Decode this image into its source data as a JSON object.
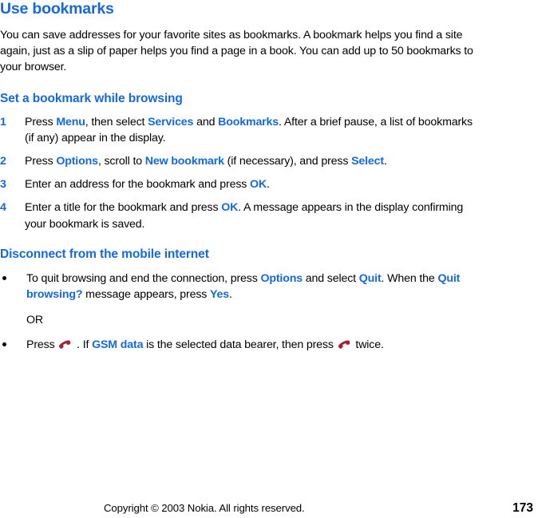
{
  "document": {
    "title": "Use bookmarks",
    "intro": {
      "before_1": "You can save addresses for your favorite sites as bookmarks. A bookmark helps you find a site again, just as a slip of paper helps you find a page in a book. You can add up to 50 bookmarks to your browser."
    },
    "sections": [
      {
        "heading": "Set a bookmark while browsing",
        "steps": [
          {
            "number": "1",
            "t1": "Press ",
            "k1": "Menu",
            "t2": ", then select ",
            "k2": "Services",
            "t3": " and ",
            "k3": "Bookmarks",
            "t4": ". After a brief pause, a list of bookmarks (if any) appear in the display."
          },
          {
            "number": "2",
            "t1": "Press ",
            "k1": "Options",
            "t2": ", scroll to ",
            "k2": "New bookmark",
            "t3": " (if necessary), and press ",
            "k3": "Select",
            "t4": "."
          },
          {
            "number": "3",
            "t1": "Enter an address for the bookmark and press ",
            "k1": "OK",
            "t2": ".",
            "k2": "",
            "t3": "",
            "k3": "",
            "t4": ""
          },
          {
            "number": "4",
            "t1": "Enter a title for the bookmark and press ",
            "k1": "OK",
            "t2": ". A message appears in the display confirming your bookmark is saved.",
            "k2": "",
            "t3": "",
            "k3": "",
            "t4": ""
          }
        ]
      },
      {
        "heading": "Disconnect from the mobile internet",
        "bullets": [
          {
            "t1": "To quit browsing and end the connection, press ",
            "k1": "Options",
            "t2": " and select ",
            "k2": "Quit",
            "t3": ". When the ",
            "k3": "Quit browsing?",
            "t4": " message appears, press ",
            "k4": "Yes",
            "t5": "."
          }
        ],
        "or_label": "OR",
        "final_bullet": {
          "t1": "Press ",
          "icon1": "end-call-handset-icon",
          "t2": " . If ",
          "k1": "GSM data",
          "t3": " is the selected data bearer, then press ",
          "icon2": "end-call-handset-icon",
          "t4": " twice."
        }
      }
    ]
  },
  "footer": {
    "copyright": "Copyright © 2003 Nokia. All rights reserved.",
    "page_number": "173"
  },
  "colors": {
    "accent_blue": "#1569e0",
    "handset_red": "#a8202e",
    "text_black": "#000000",
    "background": "#ffffff"
  }
}
